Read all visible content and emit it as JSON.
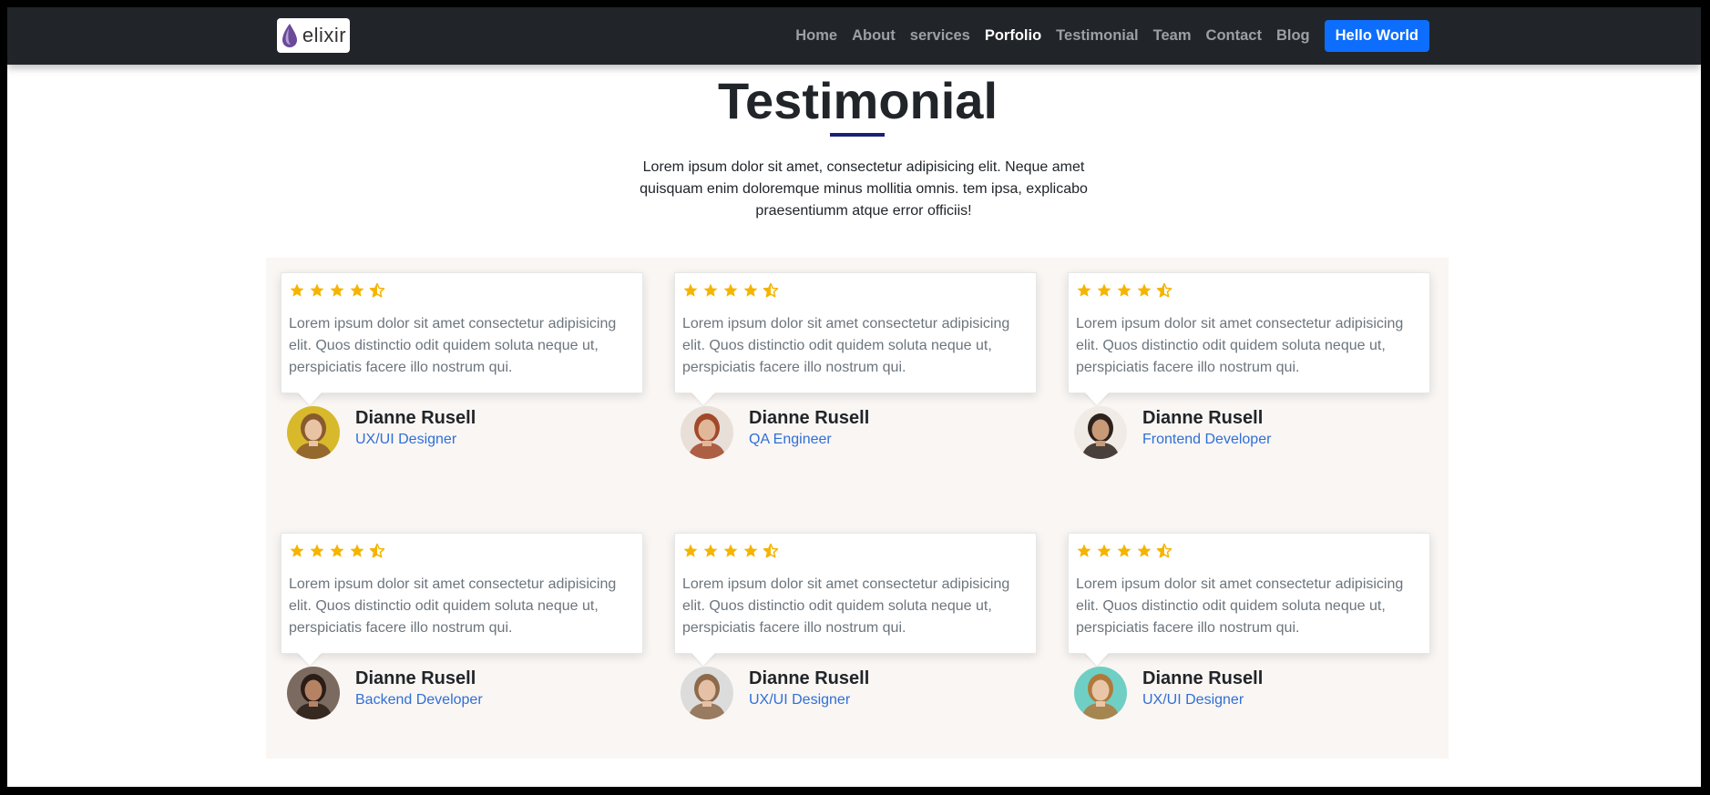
{
  "nav": {
    "logo_text": "elixir",
    "items": [
      {
        "label": "Home",
        "active": false
      },
      {
        "label": "About",
        "active": false
      },
      {
        "label": "services",
        "active": false
      },
      {
        "label": "Porfolio",
        "active": true
      },
      {
        "label": "Testimonial",
        "active": false
      },
      {
        "label": "Team",
        "active": false
      },
      {
        "label": "Contact",
        "active": false
      },
      {
        "label": "Blog",
        "active": false
      }
    ],
    "cta_label": "Hello World"
  },
  "section": {
    "title": "Testimonial",
    "description": "Lorem ipsum dolor sit amet, consectetur adipisicing elit. Neque amet quisquam enim doloremque minus mollitia omnis. tem ipsa, explicabo praesentiumm atque error officiis!"
  },
  "testimonials": [
    {
      "rating": 4.5,
      "text": "Lorem ipsum dolor sit amet consectetur adipisicing elit. Quos distinctio odit quidem soluta neque ut, perspiciatis facere illo nostrum qui.",
      "name": "Dianne Rusell",
      "role": "UX/UI Designer",
      "avatar_color": "#d8b92b",
      "skin": "#e8c4a4",
      "hair": "#8a5a2f"
    },
    {
      "rating": 4.5,
      "text": "Lorem ipsum dolor sit amet consectetur adipisicing elit. Quos distinctio odit quidem soluta neque ut, perspiciatis facere illo nostrum qui.",
      "name": "Dianne Rusell",
      "role": "QA Engineer",
      "avatar_color": "#e7dfd8",
      "skin": "#e1b79a",
      "hair": "#a2492a"
    },
    {
      "rating": 4.5,
      "text": "Lorem ipsum dolor sit amet consectetur adipisicing elit. Quos distinctio odit quidem soluta neque ut, perspiciatis facere illo nostrum qui.",
      "name": "Dianne Rusell",
      "role": "Frontend Developer",
      "avatar_color": "#f1ebe6",
      "skin": "#c99a78",
      "hair": "#2d221c"
    },
    {
      "rating": 4.5,
      "text": "Lorem ipsum dolor sit amet consectetur adipisicing elit. Quos distinctio odit quidem soluta neque ut, perspiciatis facere illo nostrum qui.",
      "name": "Dianne Rusell",
      "role": "Backend Developer",
      "avatar_color": "#7b6a5f",
      "skin": "#b58363",
      "hair": "#2a1d18"
    },
    {
      "rating": 4.5,
      "text": "Lorem ipsum dolor sit amet consectetur adipisicing elit. Quos distinctio odit quidem soluta neque ut, perspiciatis facere illo nostrum qui.",
      "name": "Dianne Rusell",
      "role": "UX/UI Designer",
      "avatar_color": "#dcdcdc",
      "skin": "#e6c0a6",
      "hair": "#8c6a4a"
    },
    {
      "rating": 4.5,
      "text": "Lorem ipsum dolor sit amet consectetur adipisicing elit. Quos distinctio odit quidem soluta neque ut, perspiciatis facere illo nostrum qui.",
      "name": "Dianne Rusell",
      "role": "UX/UI Designer",
      "avatar_color": "#6fcfc4",
      "skin": "#e9c6a8",
      "hair": "#b0793c"
    }
  ],
  "colors": {
    "star": "#f5b400",
    "accent": "#0d6efd",
    "role_link": "#2f6fd6"
  }
}
